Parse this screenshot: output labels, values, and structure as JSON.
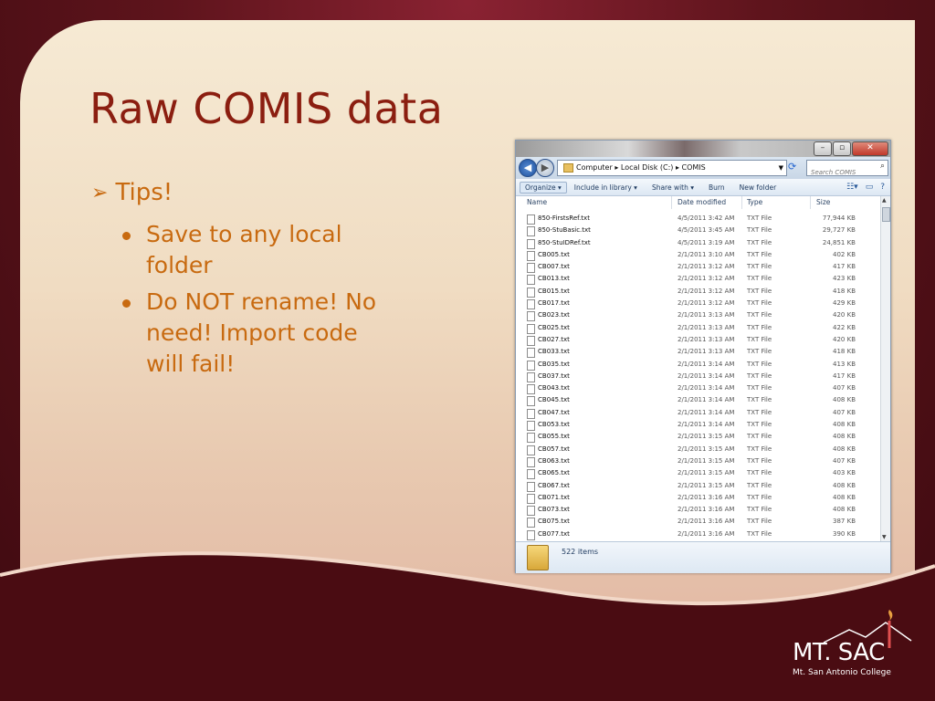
{
  "slide": {
    "title": "Raw COMIS data",
    "tips_heading": "Tips!",
    "bullets": [
      "Save to any local folder",
      "Do NOT rename! No need! Import code will fail!"
    ]
  },
  "explorer": {
    "address_path": "Computer ▸ Local Disk (C:) ▸ COMIS",
    "search_placeholder": "Search COMIS",
    "toolbar": {
      "organize": "Organize ▾",
      "include_in_library": "Include in library ▾",
      "share_with": "Share with ▾",
      "burn": "Burn",
      "new_folder": "New folder"
    },
    "columns": {
      "name": "Name",
      "date": "Date modified",
      "type": "Type",
      "size": "Size"
    },
    "files": [
      {
        "name": "850-FirstsRef.txt",
        "date": "4/5/2011 3:42 AM",
        "type": "TXT File",
        "size": "77,944 KB"
      },
      {
        "name": "850-StuBasic.txt",
        "date": "4/5/2011 3:45 AM",
        "type": "TXT File",
        "size": "29,727 KB"
      },
      {
        "name": "850-StuIDRef.txt",
        "date": "4/5/2011 3:19 AM",
        "type": "TXT File",
        "size": "24,851 KB"
      },
      {
        "name": "CB005.txt",
        "date": "2/1/2011 3:10 AM",
        "type": "TXT File",
        "size": "402 KB"
      },
      {
        "name": "CB007.txt",
        "date": "2/1/2011 3:12 AM",
        "type": "TXT File",
        "size": "417 KB"
      },
      {
        "name": "CB013.txt",
        "date": "2/1/2011 3:12 AM",
        "type": "TXT File",
        "size": "423 KB"
      },
      {
        "name": "CB015.txt",
        "date": "2/1/2011 3:12 AM",
        "type": "TXT File",
        "size": "418 KB"
      },
      {
        "name": "CB017.txt",
        "date": "2/1/2011 3:12 AM",
        "type": "TXT File",
        "size": "429 KB"
      },
      {
        "name": "CB023.txt",
        "date": "2/1/2011 3:13 AM",
        "type": "TXT File",
        "size": "420 KB"
      },
      {
        "name": "CB025.txt",
        "date": "2/1/2011 3:13 AM",
        "type": "TXT File",
        "size": "422 KB"
      },
      {
        "name": "CB027.txt",
        "date": "2/1/2011 3:13 AM",
        "type": "TXT File",
        "size": "420 KB"
      },
      {
        "name": "CB033.txt",
        "date": "2/1/2011 3:13 AM",
        "type": "TXT File",
        "size": "418 KB"
      },
      {
        "name": "CB035.txt",
        "date": "2/1/2011 3:14 AM",
        "type": "TXT File",
        "size": "413 KB"
      },
      {
        "name": "CB037.txt",
        "date": "2/1/2011 3:14 AM",
        "type": "TXT File",
        "size": "417 KB"
      },
      {
        "name": "CB043.txt",
        "date": "2/1/2011 3:14 AM",
        "type": "TXT File",
        "size": "407 KB"
      },
      {
        "name": "CB045.txt",
        "date": "2/1/2011 3:14 AM",
        "type": "TXT File",
        "size": "408 KB"
      },
      {
        "name": "CB047.txt",
        "date": "2/1/2011 3:14 AM",
        "type": "TXT File",
        "size": "407 KB"
      },
      {
        "name": "CB053.txt",
        "date": "2/1/2011 3:14 AM",
        "type": "TXT File",
        "size": "408 KB"
      },
      {
        "name": "CB055.txt",
        "date": "2/1/2011 3:15 AM",
        "type": "TXT File",
        "size": "408 KB"
      },
      {
        "name": "CB057.txt",
        "date": "2/1/2011 3:15 AM",
        "type": "TXT File",
        "size": "408 KB"
      },
      {
        "name": "CB063.txt",
        "date": "2/1/2011 3:15 AM",
        "type": "TXT File",
        "size": "407 KB"
      },
      {
        "name": "CB065.txt",
        "date": "2/1/2011 3:15 AM",
        "type": "TXT File",
        "size": "403 KB"
      },
      {
        "name": "CB067.txt",
        "date": "2/1/2011 3:15 AM",
        "type": "TXT File",
        "size": "408 KB"
      },
      {
        "name": "CB071.txt",
        "date": "2/1/2011 3:16 AM",
        "type": "TXT File",
        "size": "408 KB"
      },
      {
        "name": "CB073.txt",
        "date": "2/1/2011 3:16 AM",
        "type": "TXT File",
        "size": "408 KB"
      },
      {
        "name": "CB075.txt",
        "date": "2/1/2011 3:16 AM",
        "type": "TXT File",
        "size": "387 KB"
      },
      {
        "name": "CB077.txt",
        "date": "2/1/2011 3:16 AM",
        "type": "TXT File",
        "size": "390 KB"
      }
    ],
    "status_count": "522 items"
  },
  "logo": {
    "main": "MT. SAC",
    "sub": "Mt. San Antonio College"
  },
  "icons": {
    "back": "back-arrow-icon",
    "forward": "forward-arrow-icon",
    "refresh": "refresh-icon",
    "search": "search-icon",
    "file": "text-file-icon",
    "folder": "folder-icon"
  },
  "colors": {
    "title": "#8b1e10",
    "bullets": "#c86a10",
    "background_dark": "#5a1018",
    "panel": "#f3e2c9"
  }
}
